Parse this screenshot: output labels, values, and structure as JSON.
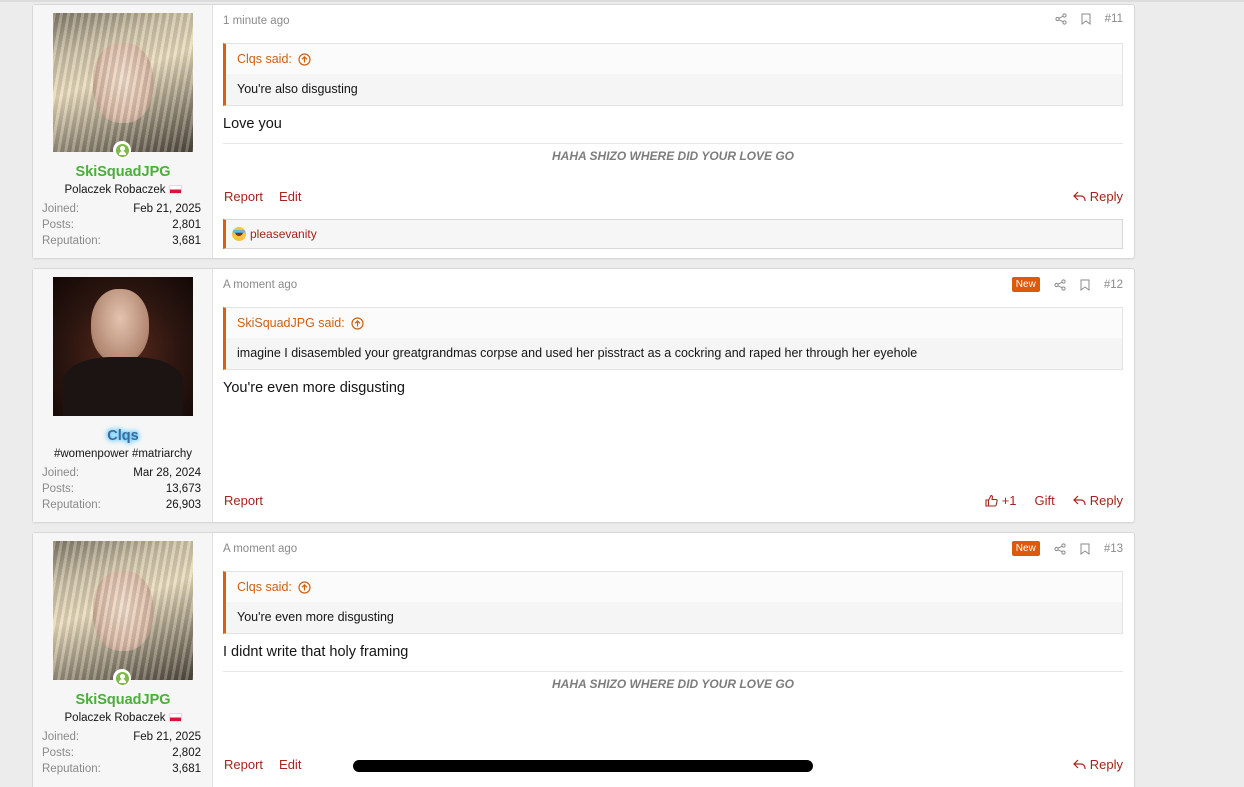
{
  "posts": [
    {
      "user": {
        "name": "SkiSquadJPG",
        "title": "Polaczek Robaczek",
        "joined_label": "Joined:",
        "joined": "Feb 21, 2025",
        "posts_label": "Posts:",
        "posts": "2,801",
        "rep_label": "Reputation:",
        "rep": "3,681"
      },
      "time": "1 minute ago",
      "number": "#11",
      "quote_author": "Clqs said:",
      "quote_text": "You're also disgusting",
      "message": "Love you",
      "signature": "HAHA SHIZO WHERE DID YOUR LOVE GO",
      "actions": {
        "report": "Report",
        "edit": "Edit",
        "reply": "Reply"
      },
      "reaction_user": "pleasevanity"
    },
    {
      "user": {
        "name": "Clqs",
        "title": "#womenpower #matriarchy",
        "joined_label": "Joined:",
        "joined": "Mar 28, 2024",
        "posts_label": "Posts:",
        "posts": "13,673",
        "rep_label": "Reputation:",
        "rep": "26,903"
      },
      "time": "A moment ago",
      "badge": "New",
      "number": "#12",
      "quote_author": "SkiSquadJPG said:",
      "quote_text": "imagine I disasembled your greatgrandmas corpse and used her pisstract as a cockring and raped her through her eyehole",
      "message": "You're even more disgusting",
      "actions": {
        "report": "Report",
        "like": "+1",
        "gift": "Gift",
        "reply": "Reply"
      }
    },
    {
      "user": {
        "name": "SkiSquadJPG",
        "title": "Polaczek Robaczek",
        "joined_label": "Joined:",
        "joined": "Feb 21, 2025",
        "posts_label": "Posts:",
        "posts": "2,802",
        "rep_label": "Reputation:",
        "rep": "3,681"
      },
      "time": "A moment ago",
      "badge": "New",
      "number": "#13",
      "quote_author": "Clqs said:",
      "quote_text": "You're even more disgusting",
      "message": "I didnt write that holy framing",
      "signature": "HAHA SHIZO WHERE DID YOUR LOVE GO",
      "actions": {
        "report": "Report",
        "edit": "Edit",
        "reply": "Reply"
      }
    }
  ],
  "icons": {
    "share": "share-icon",
    "bookmark": "bookmark-icon",
    "reply": "reply-arrow-icon",
    "like": "thumbs-up-icon",
    "quote_up": "arrow-up-circle-icon",
    "online": "online-user-icon",
    "reaction": "joy-emoji-icon"
  },
  "colors": {
    "accent": "#a3251d",
    "quote_border": "#d96010",
    "new_badge": "#dc5a0a",
    "username_green": "#4cae3a",
    "username_glow": "#3fc3ff"
  }
}
